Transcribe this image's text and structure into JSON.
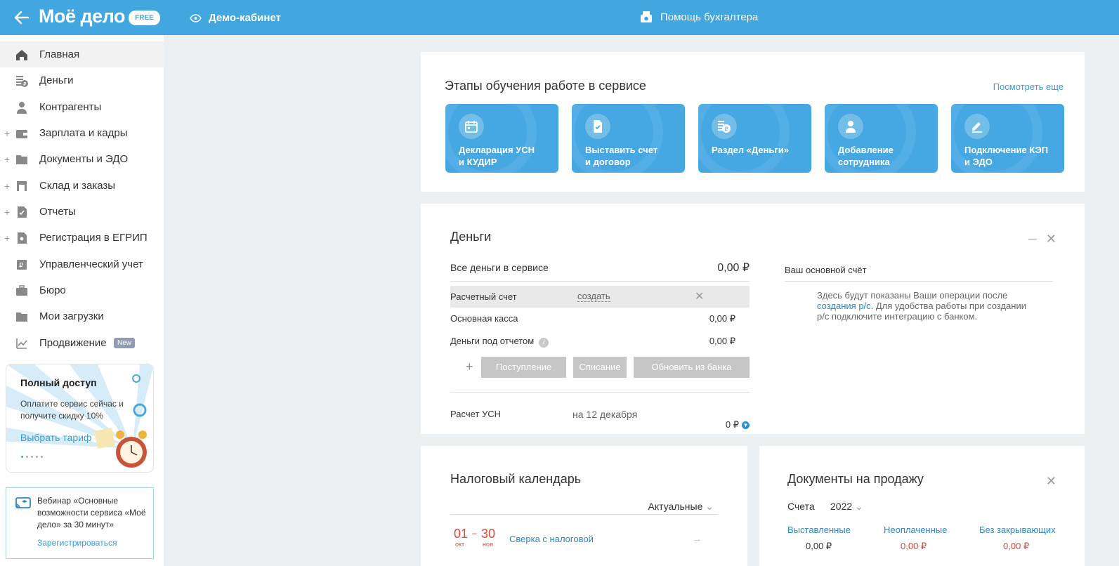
{
  "header": {
    "logo": "Моё дело",
    "plan_badge": "FREE",
    "demo_label": "Демо-кабинет",
    "help_label": "Помощь бухгалтера"
  },
  "sidebar": {
    "items": [
      {
        "label": "Главная",
        "icon": "home-icon",
        "expandable": false,
        "active": true
      },
      {
        "label": "Деньги",
        "icon": "money-icon",
        "expandable": false
      },
      {
        "label": "Контрагенты",
        "icon": "contractor-icon",
        "expandable": false
      },
      {
        "label": "Зарплата и кадры",
        "icon": "wallet-icon",
        "expandable": true
      },
      {
        "label": "Документы и ЭДО",
        "icon": "folder-icon",
        "expandable": true
      },
      {
        "label": "Склад и заказы",
        "icon": "warehouse-icon",
        "expandable": true
      },
      {
        "label": "Отчеты",
        "icon": "report-icon",
        "expandable": true
      },
      {
        "label": "Регистрация в ЕГРИП",
        "icon": "registration-icon",
        "expandable": true
      },
      {
        "label": "Управленческий учет",
        "icon": "management-icon",
        "expandable": false
      },
      {
        "label": "Бюро",
        "icon": "briefcase-icon",
        "expandable": false
      },
      {
        "label": "Мои загрузки",
        "icon": "folder-icon",
        "expandable": false
      },
      {
        "label": "Продвижение",
        "icon": "chart-icon",
        "expandable": false,
        "badge": "New"
      }
    ],
    "promo": {
      "title": "Полный доступ",
      "text": "Оплатите сервис сейчас и получите скидку 10%",
      "link": "Выбрать тариф"
    },
    "webinar": {
      "text": "Вебинар «Основные возможности сервиса «Моё дело» за 30 минут»",
      "link": "Зарегистрироваться"
    }
  },
  "stages": {
    "title": "Этапы обучения работе в сервисе",
    "more_link": "Посмотреть еще",
    "cards": [
      {
        "line1": "Декларация УСН",
        "line2": "и КУДИР",
        "icon": "calendar-icon"
      },
      {
        "line1": "Выставить счет",
        "line2": "и договор",
        "icon": "document-check-icon"
      },
      {
        "line1": "Раздел «Деньги»",
        "line2": "",
        "icon": "money-icon"
      },
      {
        "line1": "Добавление",
        "line2": "сотрудника",
        "icon": "employee-icon"
      },
      {
        "line1": "Подключение КЭП",
        "line2": "и ЭДО",
        "icon": "signature-icon"
      }
    ]
  },
  "money": {
    "title": "Деньги",
    "all_label": "Все деньги в сервисе",
    "all_value": "0,00 ₽",
    "account_label": "Расчетный счет",
    "account_create": "создать",
    "cash_label": "Основная касса",
    "cash_value": "0,00 ₽",
    "report_label": "Деньги под отчетом",
    "report_value": "0,00 ₽",
    "btn_income": "Поступление",
    "btn_writeoff": "Списание",
    "btn_bank": "Обновить из банка",
    "usn_label": "Расчет УСН",
    "usn_date": "на 12 декабря",
    "usn_value": "0 ₽",
    "main_account_title": "Ваш основной счёт",
    "main_account_desc_1": "Здесь будут показаны Ваши операции после",
    "main_account_link": "создания р/с",
    "main_account_desc_2": ". Для удобства работы при создании р/с подключите интеграцию с банком."
  },
  "tax_calendar": {
    "title": "Налоговый календарь",
    "filter": "Актуальные",
    "day_from": "01",
    "month_from": "окт",
    "day_to": "30",
    "month_to": "ноя",
    "event": "Сверка с налоговой"
  },
  "docs_sale": {
    "title": "Документы на продажу",
    "period_label": "Счета",
    "year": "2022",
    "columns": [
      {
        "label": "Выставленные",
        "value": "0,00 ₽",
        "color": "#333333"
      },
      {
        "label": "Неоплаченные",
        "value": "0,00 ₽",
        "color": "#e0453a"
      },
      {
        "label": "Без закрывающих",
        "value": "0,00 ₽",
        "color": "#e0453a"
      }
    ]
  },
  "colors": {
    "brand": "#42a6e0",
    "link": "#2d86c6",
    "danger": "#e0453a"
  }
}
